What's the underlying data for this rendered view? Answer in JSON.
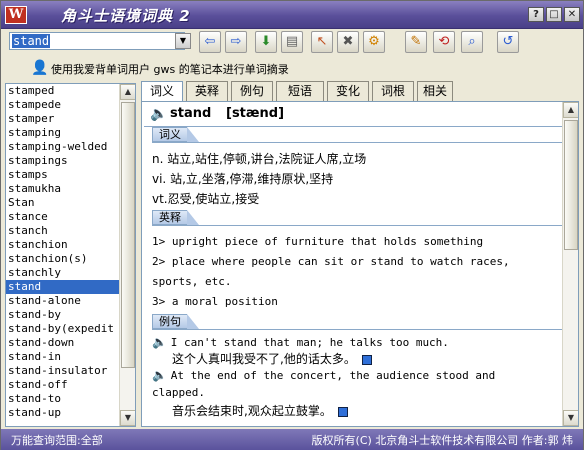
{
  "window": {
    "title": "角斗士语境词典 2",
    "app_icon": "W",
    "min_label": "?",
    "max_label": "□",
    "close_label": "✕"
  },
  "search": {
    "value": "stand"
  },
  "toolbar": {
    "buttons": [
      {
        "icon": "back-arrow-icon",
        "glyph": "⇦"
      },
      {
        "icon": "forward-arrow-icon",
        "glyph": "⇨"
      },
      {
        "icon": "download-icon",
        "glyph": "⬇"
      },
      {
        "icon": "database-icon",
        "glyph": "▤"
      },
      {
        "icon": "cursor-select-icon",
        "glyph": "↖"
      },
      {
        "icon": "tools-icon",
        "glyph": "✖"
      },
      {
        "icon": "gear-icon",
        "glyph": "⚙"
      },
      {
        "icon": "notebook-icon",
        "glyph": "✎"
      },
      {
        "icon": "link-icon",
        "glyph": "⟲"
      },
      {
        "icon": "magnifier-icon",
        "glyph": "⌕"
      },
      {
        "icon": "undo-icon",
        "glyph": "↺"
      }
    ]
  },
  "user": {
    "text": "使用我爱背单词用户 gws 的笔记本进行单词摘录"
  },
  "wordlist": {
    "items": [
      "stamped",
      "stampede",
      "stamper",
      "stamping",
      "stamping-welded",
      "stampings",
      "stamps",
      "stamukha",
      "Stan",
      "stance",
      "stanch",
      "stanchion",
      "stanchion(s)",
      "stanchly",
      "stand",
      "stand-alone",
      "stand-by",
      "stand-by(expedit",
      "stand-down",
      "stand-in",
      "stand-insulator",
      "stand-off",
      "stand-to",
      "stand-up"
    ],
    "selected": "stand"
  },
  "tabs": [
    "词义",
    "英释",
    "例句",
    "短语",
    "变化",
    "词根",
    "相关"
  ],
  "entry": {
    "word": "stand",
    "phonetic": "[stænd]",
    "sections": {
      "meaning": "词义",
      "english": "英释",
      "examples": "例句"
    },
    "meanings": [
      "n. 站立,站住,停顿,讲台,法院证人席,立场",
      "vi. 站,立,坐落,停滞,维持原状,坚持",
      "vt.忍受,使站立,接受"
    ],
    "english": [
      "1> upright piece of furniture that holds something",
      "2> place where people can sit or stand to watch races,",
      "sports, etc.",
      "3> a moral position"
    ],
    "examples": [
      {
        "en": "I can't stand that man; he talks too much.",
        "zh": "这个人真叫我受不了,他的话太多。"
      },
      {
        "en": "At the end of the concert, the audience stood and",
        "en2": "clapped.",
        "zh": "音乐会结束时,观众起立鼓掌。"
      }
    ]
  },
  "status": {
    "left": "万能查询范围:全部",
    "right": "版权所有(C) 北京角斗士软件技术有限公司 作者:郭 炜"
  },
  "colors": {
    "titlebar": "#5a4f9a",
    "selection": "#316ac5",
    "section_tag": "#b4c9e6"
  }
}
